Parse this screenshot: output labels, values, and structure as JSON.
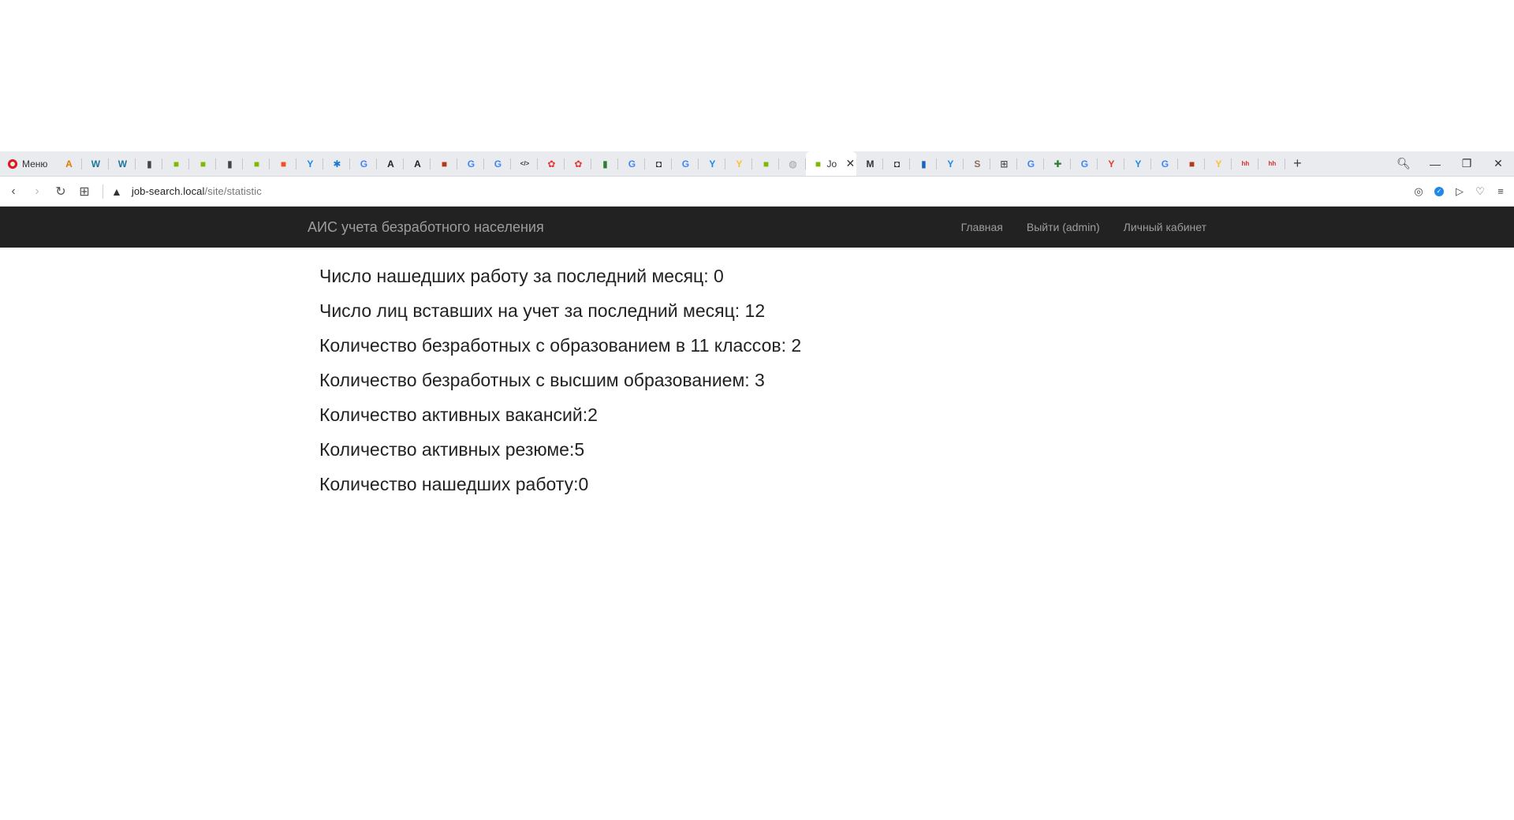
{
  "browser": {
    "menu_label": "Меню",
    "tabs": [
      {
        "icon": "amazon-like-icon",
        "color": "#e07b00",
        "glyph": "A"
      },
      {
        "icon": "wordpress-icon",
        "color": "#21759b",
        "glyph": "W"
      },
      {
        "icon": "wordpress-icon",
        "color": "#21759b",
        "glyph": "W"
      },
      {
        "icon": "document-icon",
        "color": "#444444",
        "glyph": "▮"
      },
      {
        "icon": "microsoft-icon",
        "color": "#7fba00",
        "glyph": "■"
      },
      {
        "icon": "microsoft-icon",
        "color": "#7fba00",
        "glyph": "■"
      },
      {
        "icon": "document-icon",
        "color": "#444444",
        "glyph": "▮"
      },
      {
        "icon": "microsoft-icon",
        "color": "#7fba00",
        "glyph": "■"
      },
      {
        "icon": "microsoft-icon",
        "color": "#f25022",
        "glyph": "■"
      },
      {
        "icon": "yandex-icon",
        "color": "#1e88e5",
        "glyph": "Y"
      },
      {
        "icon": "puzzle-icon",
        "color": "#1976d2",
        "glyph": "✱"
      },
      {
        "icon": "google-icon",
        "color": "#4285f4",
        "glyph": "G"
      },
      {
        "icon": "font-icon",
        "color": "#222222",
        "glyph": "A"
      },
      {
        "icon": "font-icon",
        "color": "#222222",
        "glyph": "A"
      },
      {
        "icon": "blocks-icon",
        "color": "#b23a1a",
        "glyph": "■"
      },
      {
        "icon": "google-icon",
        "color": "#4285f4",
        "glyph": "G"
      },
      {
        "icon": "google-icon",
        "color": "#4285f4",
        "glyph": "G"
      },
      {
        "icon": "code-icon",
        "color": "#333333",
        "glyph": "</>"
      },
      {
        "icon": "flower-icon",
        "color": "#e53935",
        "glyph": "✿"
      },
      {
        "icon": "flower-icon",
        "color": "#e53935",
        "glyph": "✿"
      },
      {
        "icon": "bookmark-icon",
        "color": "#2e7d32",
        "glyph": "▮"
      },
      {
        "icon": "google-icon",
        "color": "#4285f4",
        "glyph": "G"
      },
      {
        "icon": "app-icon",
        "color": "#263238",
        "glyph": "◘"
      },
      {
        "icon": "google-icon",
        "color": "#4285f4",
        "glyph": "G"
      },
      {
        "icon": "yandex-icon",
        "color": "#1e88e5",
        "glyph": "Y"
      },
      {
        "icon": "yandex-icon",
        "color": "#fbc02d",
        "glyph": "Y"
      },
      {
        "icon": "microsoft-icon",
        "color": "#7fba00",
        "glyph": "■"
      },
      {
        "icon": "globe-icon",
        "color": "#9e9e9e",
        "glyph": "◍"
      }
    ],
    "active_tab": {
      "icon": "microsoft-icon",
      "color": "#7fba00",
      "title": "Jo"
    },
    "tabs_after": [
      {
        "icon": "gmail-icon",
        "color": "#333333",
        "glyph": "M"
      },
      {
        "icon": "app-icon",
        "color": "#263238",
        "glyph": "◘"
      },
      {
        "icon": "chart-icon",
        "color": "#1565c0",
        "glyph": "▮"
      },
      {
        "icon": "yandex-icon",
        "color": "#1e88e5",
        "glyph": "Y"
      },
      {
        "icon": "sublime-icon",
        "color": "#8d6e63",
        "glyph": "S"
      },
      {
        "icon": "grid-icon",
        "color": "#555555",
        "glyph": "⊞"
      },
      {
        "icon": "google-icon",
        "color": "#4285f4",
        "glyph": "G"
      },
      {
        "icon": "puzzle-icon",
        "color": "#2e7d32",
        "glyph": "✚"
      },
      {
        "icon": "google-icon",
        "color": "#4285f4",
        "glyph": "G"
      },
      {
        "icon": "yandex-icon",
        "color": "#e53935",
        "glyph": "Y"
      },
      {
        "icon": "yandex-icon",
        "color": "#1e88e5",
        "glyph": "Y"
      },
      {
        "icon": "google-icon",
        "color": "#4285f4",
        "glyph": "G"
      },
      {
        "icon": "blocks-icon",
        "color": "#b23a1a",
        "glyph": "■"
      },
      {
        "icon": "yandex-icon",
        "color": "#fbc02d",
        "glyph": "Y"
      },
      {
        "icon": "hh-icon",
        "color": "#d32f2f",
        "glyph": "hh"
      },
      {
        "icon": "hh-icon",
        "color": "#d32f2f",
        "glyph": "hh"
      }
    ],
    "new_tab_label": "+",
    "url_host": "job-search.local",
    "url_path": "/site/statistic"
  },
  "navbar": {
    "brand": "АИС учета безработного населения",
    "links": [
      "Главная",
      "Выйти (admin)",
      "Личный кабинет"
    ]
  },
  "stats": [
    "Число нашедших работу за последний месяц: 0",
    "Число лиц вставших на учет за последний месяц: 12",
    "Количество безработных с образованием в 11 классов: 2",
    "Количество безработных с высшим образованием: 3",
    "Количество активных вакансий:2",
    "Количество активных резюме:5",
    "Количество нашедших работу:0"
  ]
}
